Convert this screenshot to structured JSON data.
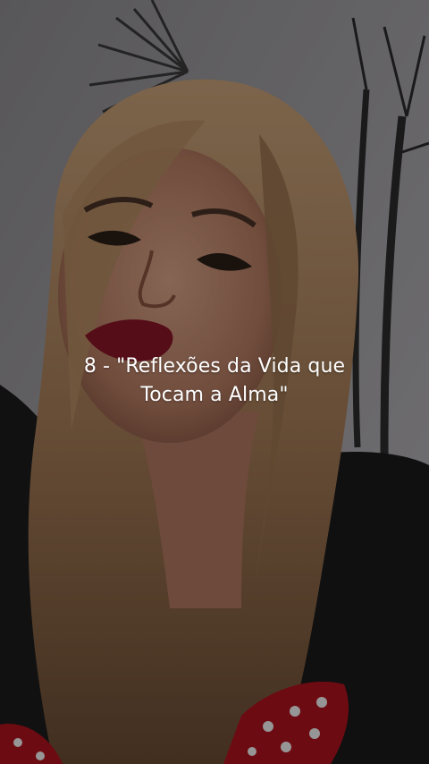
{
  "caption": {
    "line1": "8 - \"Reflexões da Vida que",
    "line2": "Tocam a Alma\""
  },
  "colors": {
    "caption_text": "#ffffff",
    "overlay": "rgba(0,0,0,0.38)"
  }
}
